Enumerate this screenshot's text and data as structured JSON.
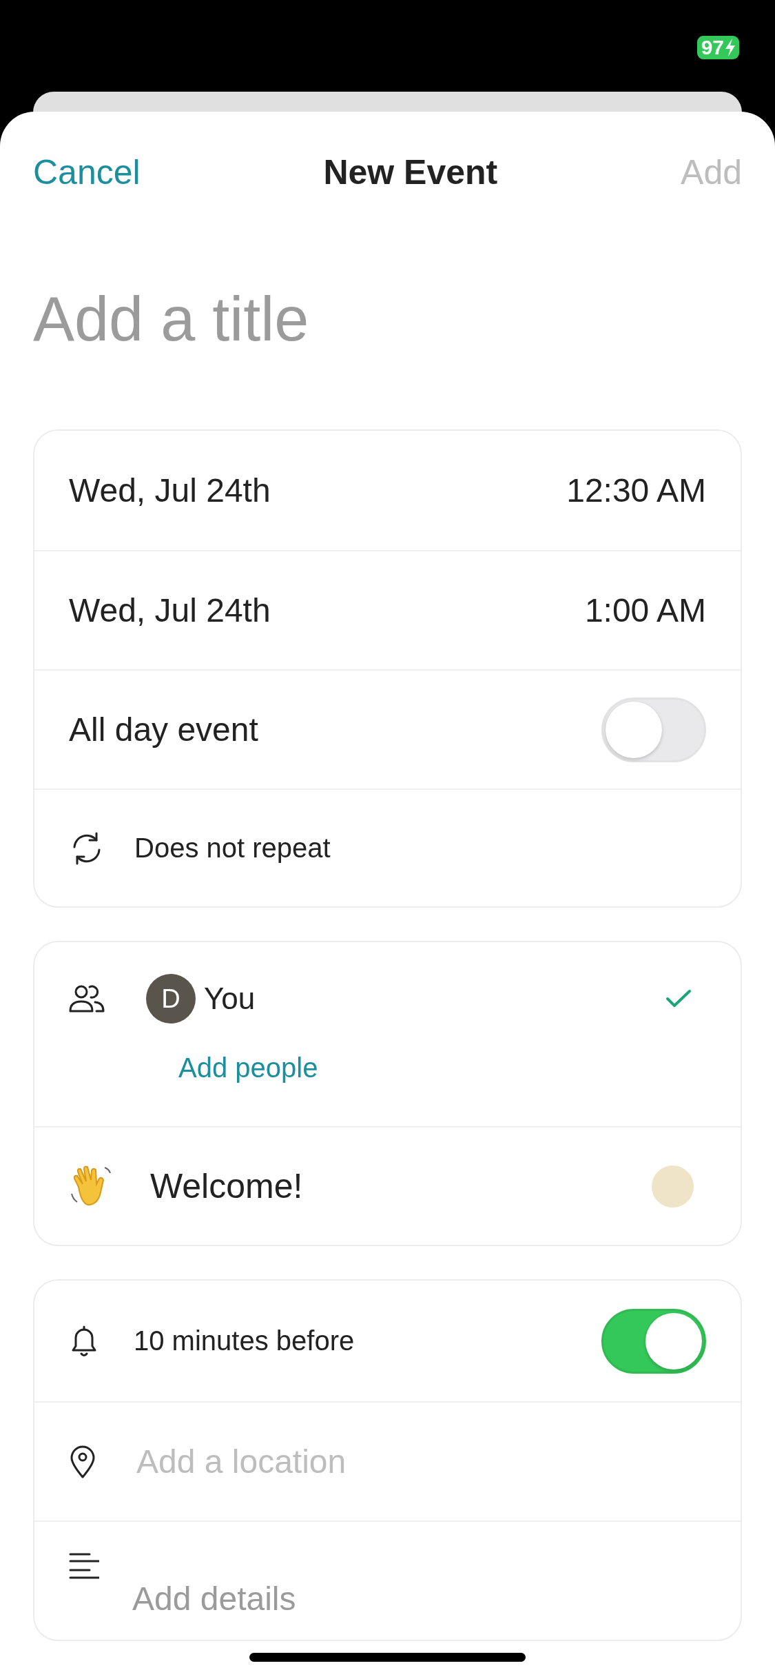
{
  "status_bar": {
    "battery": "97"
  },
  "header": {
    "cancel": "Cancel",
    "title": "New Event",
    "add": "Add",
    "add_disabled": true
  },
  "title_field": {
    "placeholder": "Add a title"
  },
  "time_card": {
    "start": {
      "date": "Wed, Jul 24th",
      "time": "12:30 AM"
    },
    "end": {
      "date": "Wed, Jul 24th",
      "time": "1:00 AM"
    },
    "all_day": {
      "label": "All day event",
      "on": false
    },
    "repeat": {
      "label": "Does not repeat"
    }
  },
  "people_card": {
    "attendees": [
      {
        "initial": "D",
        "name": "You",
        "checked": true
      }
    ],
    "add_people": "Add people",
    "title_row": {
      "value": "Welcome!"
    }
  },
  "alert_card": {
    "reminder": {
      "label": "10 minutes before",
      "on": true
    },
    "location": {
      "placeholder": "Add a location"
    },
    "details": {
      "placeholder": "Add details"
    }
  }
}
